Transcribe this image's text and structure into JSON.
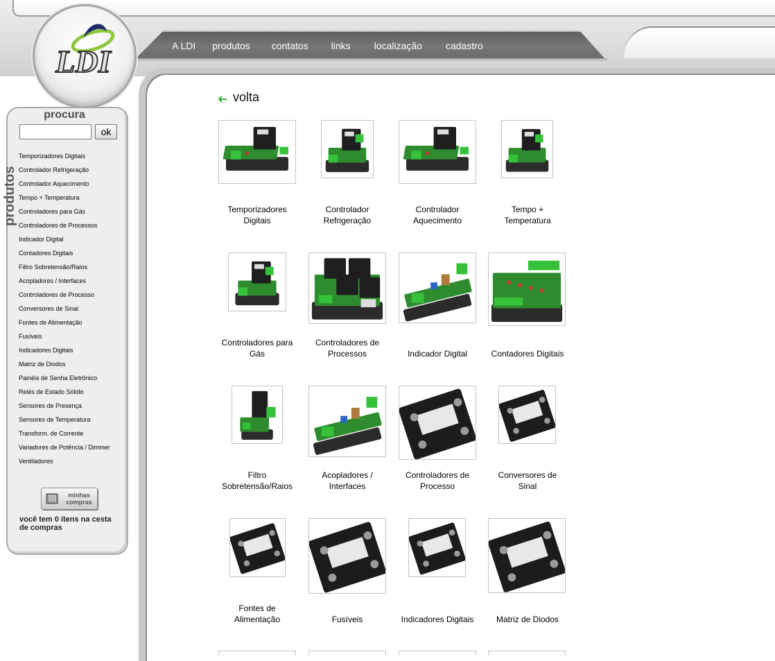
{
  "brand": {
    "logo_text": "LDI"
  },
  "nav": {
    "items": [
      {
        "label": "A LDI"
      },
      {
        "label": "produtos"
      },
      {
        "label": "contatos"
      },
      {
        "label": "links"
      },
      {
        "label": "localização"
      },
      {
        "label": "cadastro"
      }
    ]
  },
  "sidebar": {
    "vertical_label": "produtos",
    "search": {
      "title": "procura",
      "value": "",
      "button": "ok"
    },
    "categories": [
      "Temporizadores Digitais",
      "Controlador Refrigeração",
      "Controlador Aquecimento",
      "Tempo + Temperatura",
      "Controladores para Gás",
      "Controladores de Processos",
      "Indicador Digital",
      "Contadores Digitais",
      "Filtro Sobretensão/Raios",
      "Acopladores / Interfaces",
      "Controladores de Processo",
      "Conversores de Sinal",
      "Fontes de Alimentação",
      "Fusíveis",
      "Indicadores Digitais",
      "Matriz de Diodos",
      "Painéis de Senha Eletrônico",
      "Relés de Estado Sólido",
      "Sensores de Presença",
      "Sensores de Temperatura",
      "Transform. de Corrente",
      "Variadores de Potência / Dimmer",
      "Ventiladores"
    ],
    "cart": {
      "button_line1": "minhas",
      "button_line2": "compras",
      "status": "você tem 0 ítens na cesta de compras"
    }
  },
  "main": {
    "back_label": "volta",
    "products": [
      {
        "line1": "Temporizadores",
        "line2": "Digitais",
        "kind": "relay-board"
      },
      {
        "line1": "Controlador",
        "line2": "Refrigeração",
        "kind": "relay-small"
      },
      {
        "line1": "Controlador",
        "line2": "Aquecimento",
        "kind": "relay-board"
      },
      {
        "line1": "Tempo +",
        "line2": "Temperatura",
        "kind": "relay-small"
      },
      {
        "line1": "Controladores para",
        "line2": "Gás",
        "kind": "relay-small"
      },
      {
        "line1": "Controladores de",
        "line2": "Processos",
        "kind": "quad-relay"
      },
      {
        "line1": "",
        "line2": "Indicador Digital",
        "kind": "long-board"
      },
      {
        "line1": "",
        "line2": "Contadores Digitais",
        "kind": "multi-terminal"
      },
      {
        "line1": "Filtro",
        "line2": "Sobretensão/Raios",
        "kind": "tall-module"
      },
      {
        "line1": "Acopladores /",
        "line2": "Interfaces",
        "kind": "long-board"
      },
      {
        "line1": "Controladores de",
        "line2": "Processo",
        "kind": "ssr"
      },
      {
        "line1": "Conversores de",
        "line2": "Sinal",
        "kind": "ssr"
      },
      {
        "line1": "Fontes de",
        "line2": "Alimentação",
        "kind": "ssr"
      },
      {
        "line1": "",
        "line2": "Fusíveis",
        "kind": "ssr"
      },
      {
        "line1": "",
        "line2": "Indicadores Digitais",
        "kind": "ssr"
      },
      {
        "line1": "",
        "line2": "Matriz de Diodos",
        "kind": "ssr"
      }
    ]
  },
  "colors": {
    "pcb_green": "#2e8b2e",
    "terminal_green": "#35c23a",
    "relay_black": "#1e1e1e",
    "nav_gray": "#6a6a6a"
  }
}
